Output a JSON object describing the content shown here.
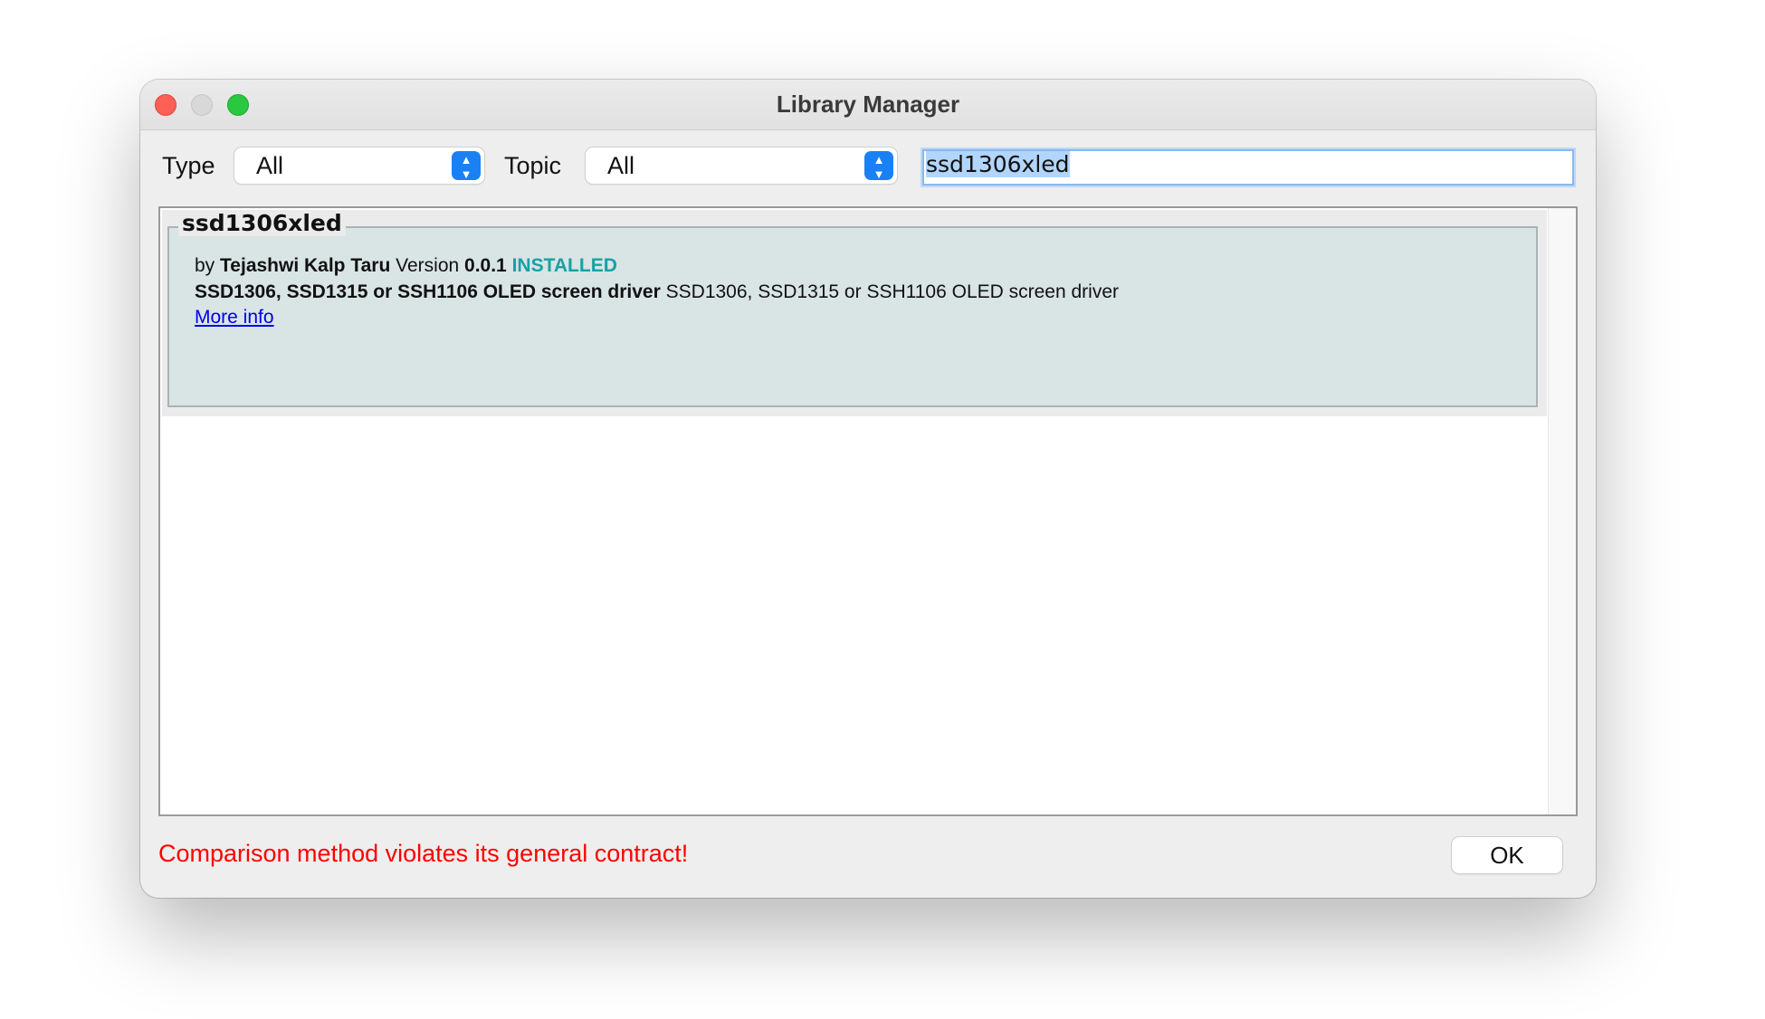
{
  "window": {
    "title": "Library Manager"
  },
  "toolbar": {
    "type_label": "Type",
    "type_value": "All",
    "topic_label": "Topic",
    "topic_value": "All",
    "search_value": "ssd1306xled"
  },
  "library": {
    "name": "ssd1306xled",
    "by": "by",
    "author": "Tejashwi Kalp Taru",
    "version_label": "Version",
    "version": "0.0.1",
    "status": "INSTALLED",
    "sentence_bold": "SSD1306, SSD1315 or SSH1106 OLED screen driver",
    "sentence": "SSD1306, SSD1315 or SSH1106 OLED screen driver",
    "more_info": "More info"
  },
  "footer": {
    "error_message": "Comparison method violates its general contract!",
    "ok_label": "OK"
  },
  "colors": {
    "installed": "#17a1a5",
    "error": "#ff0000",
    "link": "#0000ee",
    "select_accent": "#1a81f5",
    "row_background": "#d9e4e4"
  }
}
